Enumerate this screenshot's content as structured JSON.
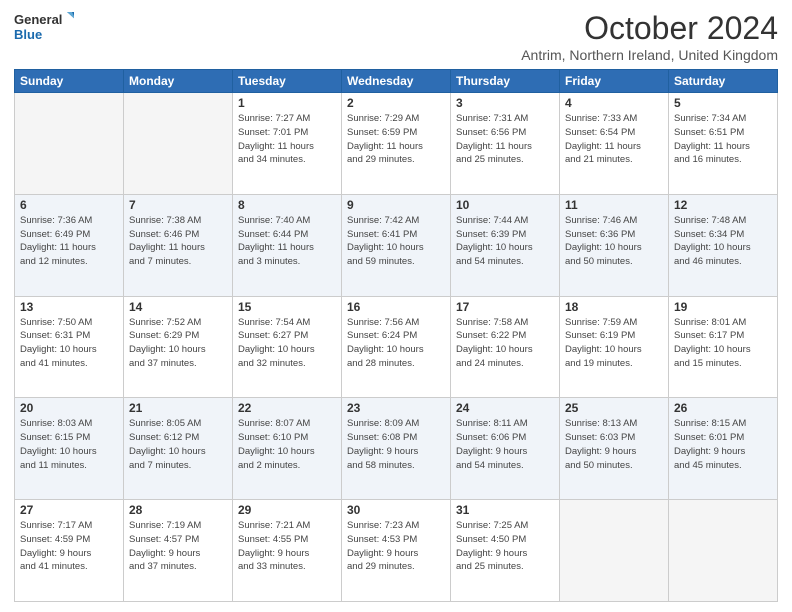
{
  "header": {
    "logo_general": "General",
    "logo_blue": "Blue",
    "month_title": "October 2024",
    "location": "Antrim, Northern Ireland, United Kingdom"
  },
  "days_of_week": [
    "Sunday",
    "Monday",
    "Tuesday",
    "Wednesday",
    "Thursday",
    "Friday",
    "Saturday"
  ],
  "weeks": [
    [
      {
        "day": "",
        "info": ""
      },
      {
        "day": "",
        "info": ""
      },
      {
        "day": "1",
        "info": "Sunrise: 7:27 AM\nSunset: 7:01 PM\nDaylight: 11 hours\nand 34 minutes."
      },
      {
        "day": "2",
        "info": "Sunrise: 7:29 AM\nSunset: 6:59 PM\nDaylight: 11 hours\nand 29 minutes."
      },
      {
        "day": "3",
        "info": "Sunrise: 7:31 AM\nSunset: 6:56 PM\nDaylight: 11 hours\nand 25 minutes."
      },
      {
        "day": "4",
        "info": "Sunrise: 7:33 AM\nSunset: 6:54 PM\nDaylight: 11 hours\nand 21 minutes."
      },
      {
        "day": "5",
        "info": "Sunrise: 7:34 AM\nSunset: 6:51 PM\nDaylight: 11 hours\nand 16 minutes."
      }
    ],
    [
      {
        "day": "6",
        "info": "Sunrise: 7:36 AM\nSunset: 6:49 PM\nDaylight: 11 hours\nand 12 minutes."
      },
      {
        "day": "7",
        "info": "Sunrise: 7:38 AM\nSunset: 6:46 PM\nDaylight: 11 hours\nand 7 minutes."
      },
      {
        "day": "8",
        "info": "Sunrise: 7:40 AM\nSunset: 6:44 PM\nDaylight: 11 hours\nand 3 minutes."
      },
      {
        "day": "9",
        "info": "Sunrise: 7:42 AM\nSunset: 6:41 PM\nDaylight: 10 hours\nand 59 minutes."
      },
      {
        "day": "10",
        "info": "Sunrise: 7:44 AM\nSunset: 6:39 PM\nDaylight: 10 hours\nand 54 minutes."
      },
      {
        "day": "11",
        "info": "Sunrise: 7:46 AM\nSunset: 6:36 PM\nDaylight: 10 hours\nand 50 minutes."
      },
      {
        "day": "12",
        "info": "Sunrise: 7:48 AM\nSunset: 6:34 PM\nDaylight: 10 hours\nand 46 minutes."
      }
    ],
    [
      {
        "day": "13",
        "info": "Sunrise: 7:50 AM\nSunset: 6:31 PM\nDaylight: 10 hours\nand 41 minutes."
      },
      {
        "day": "14",
        "info": "Sunrise: 7:52 AM\nSunset: 6:29 PM\nDaylight: 10 hours\nand 37 minutes."
      },
      {
        "day": "15",
        "info": "Sunrise: 7:54 AM\nSunset: 6:27 PM\nDaylight: 10 hours\nand 32 minutes."
      },
      {
        "day": "16",
        "info": "Sunrise: 7:56 AM\nSunset: 6:24 PM\nDaylight: 10 hours\nand 28 minutes."
      },
      {
        "day": "17",
        "info": "Sunrise: 7:58 AM\nSunset: 6:22 PM\nDaylight: 10 hours\nand 24 minutes."
      },
      {
        "day": "18",
        "info": "Sunrise: 7:59 AM\nSunset: 6:19 PM\nDaylight: 10 hours\nand 19 minutes."
      },
      {
        "day": "19",
        "info": "Sunrise: 8:01 AM\nSunset: 6:17 PM\nDaylight: 10 hours\nand 15 minutes."
      }
    ],
    [
      {
        "day": "20",
        "info": "Sunrise: 8:03 AM\nSunset: 6:15 PM\nDaylight: 10 hours\nand 11 minutes."
      },
      {
        "day": "21",
        "info": "Sunrise: 8:05 AM\nSunset: 6:12 PM\nDaylight: 10 hours\nand 7 minutes."
      },
      {
        "day": "22",
        "info": "Sunrise: 8:07 AM\nSunset: 6:10 PM\nDaylight: 10 hours\nand 2 minutes."
      },
      {
        "day": "23",
        "info": "Sunrise: 8:09 AM\nSunset: 6:08 PM\nDaylight: 9 hours\nand 58 minutes."
      },
      {
        "day": "24",
        "info": "Sunrise: 8:11 AM\nSunset: 6:06 PM\nDaylight: 9 hours\nand 54 minutes."
      },
      {
        "day": "25",
        "info": "Sunrise: 8:13 AM\nSunset: 6:03 PM\nDaylight: 9 hours\nand 50 minutes."
      },
      {
        "day": "26",
        "info": "Sunrise: 8:15 AM\nSunset: 6:01 PM\nDaylight: 9 hours\nand 45 minutes."
      }
    ],
    [
      {
        "day": "27",
        "info": "Sunrise: 7:17 AM\nSunset: 4:59 PM\nDaylight: 9 hours\nand 41 minutes."
      },
      {
        "day": "28",
        "info": "Sunrise: 7:19 AM\nSunset: 4:57 PM\nDaylight: 9 hours\nand 37 minutes."
      },
      {
        "day": "29",
        "info": "Sunrise: 7:21 AM\nSunset: 4:55 PM\nDaylight: 9 hours\nand 33 minutes."
      },
      {
        "day": "30",
        "info": "Sunrise: 7:23 AM\nSunset: 4:53 PM\nDaylight: 9 hours\nand 29 minutes."
      },
      {
        "day": "31",
        "info": "Sunrise: 7:25 AM\nSunset: 4:50 PM\nDaylight: 9 hours\nand 25 minutes."
      },
      {
        "day": "",
        "info": ""
      },
      {
        "day": "",
        "info": ""
      }
    ]
  ]
}
